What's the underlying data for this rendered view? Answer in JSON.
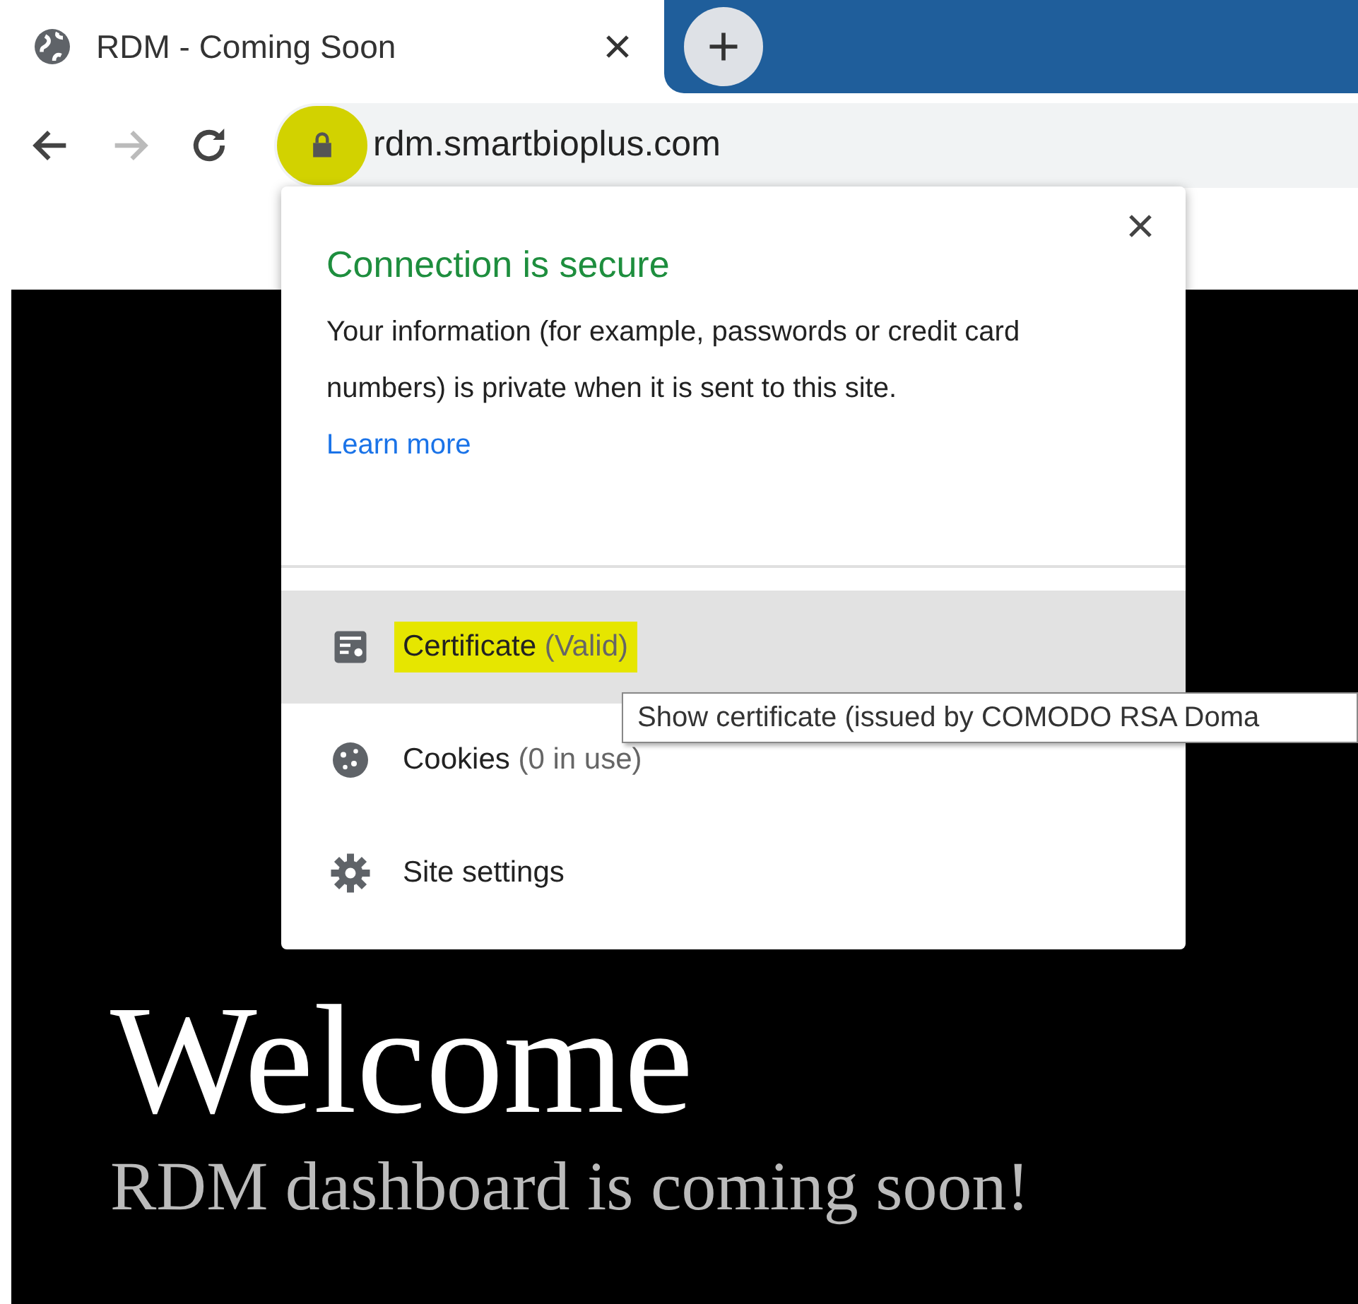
{
  "tab": {
    "title": "RDM - Coming Soon",
    "selected": true
  },
  "address_bar": {
    "url": "rdm.smartbioplus.com",
    "lock_highlighted": true
  },
  "site_info_popup": {
    "title": "Connection is secure",
    "description": "Your information (for example, passwords or credit card numbers) is private when it is sent to this site.",
    "link": "Learn more",
    "items": [
      {
        "kind": "certificate",
        "label": "Certificate",
        "detail": "(Valid)",
        "selected": true,
        "highlighted": true
      },
      {
        "kind": "cookies",
        "label": "Cookies",
        "detail": "(0 in use)",
        "selected": false,
        "highlighted": false
      },
      {
        "kind": "settings",
        "label": "Site settings",
        "selected": false,
        "highlighted": false
      }
    ]
  },
  "tooltip": "Show certificate (issued by COMODO RSA Doma",
  "page": {
    "heading": "Welcome",
    "subheading": "RDM dashboard is coming soon!"
  }
}
